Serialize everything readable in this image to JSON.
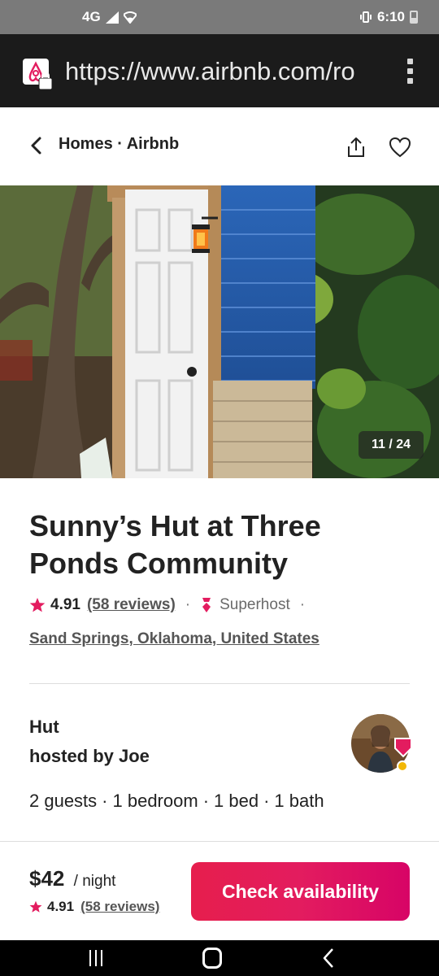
{
  "status_bar": {
    "network": "4G",
    "time": "6:10"
  },
  "browser": {
    "url": "https://www.airbnb.com/ro"
  },
  "nav": {
    "title": "Homes · Airbnb"
  },
  "gallery": {
    "counter": "11 / 24"
  },
  "listing": {
    "title": "Sunny’s Hut at Three Ponds Community",
    "rating": "4.91",
    "reviews": "(58 reviews)",
    "superhost": "Superhost",
    "location": "Sand Springs, Oklahoma, United States",
    "type": "Hut",
    "host": "hosted by Joe",
    "guests": "2 guests",
    "bedrooms": "1 bedroom",
    "beds": "1 bed",
    "baths": "1 bath"
  },
  "booking": {
    "price": "$42",
    "per": "/ night",
    "rating": "4.91",
    "reviews": "(58 reviews)",
    "cta": "Check availability"
  },
  "colors": {
    "brand": "#E31C5F",
    "text": "#222222",
    "muted": "#6A6A6A"
  }
}
